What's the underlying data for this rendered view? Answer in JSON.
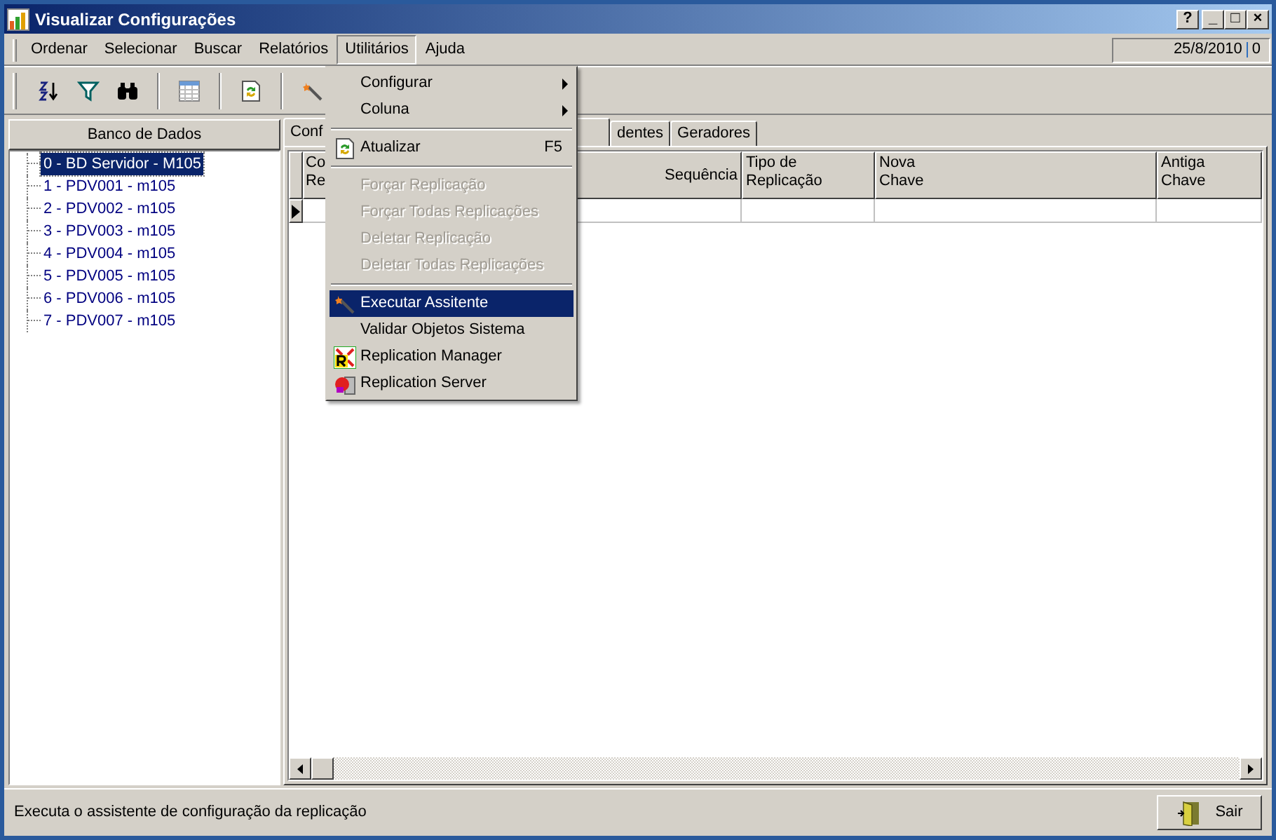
{
  "window": {
    "title": "Visualizar Configurações",
    "controls": [
      "?",
      "_",
      "□",
      "×"
    ]
  },
  "menubar": [
    {
      "label": "Ordenar",
      "open": false
    },
    {
      "label": "Selecionar",
      "open": false
    },
    {
      "label": "Buscar",
      "open": false
    },
    {
      "label": "Relatórios",
      "open": false
    },
    {
      "label": "Utilitários",
      "open": true
    },
    {
      "label": "Ajuda",
      "open": false
    }
  ],
  "status_info": {
    "date": "25/8/2010",
    "count": "0"
  },
  "toolbar": [
    {
      "kind": "sort"
    },
    {
      "kind": "filter"
    },
    {
      "kind": "find"
    },
    {
      "kind": "separator"
    },
    {
      "kind": "grid"
    },
    {
      "kind": "separator"
    },
    {
      "kind": "refresh"
    },
    {
      "kind": "separator"
    },
    {
      "kind": "wizard"
    }
  ],
  "sidebar": {
    "header": "Banco de Dados",
    "items": [
      {
        "label": "0 - BD Servidor - M105",
        "selected": true
      },
      {
        "label": "1 - PDV001 - m105",
        "selected": false
      },
      {
        "label": "2 - PDV002 - m105",
        "selected": false
      },
      {
        "label": "3 - PDV003 - m105",
        "selected": false
      },
      {
        "label": "4 - PDV004 - m105",
        "selected": false
      },
      {
        "label": "5 - PDV005 - m105",
        "selected": false
      },
      {
        "label": "6 - PDV006 - m105",
        "selected": false
      },
      {
        "label": "7 - PDV007 - m105",
        "selected": false
      }
    ]
  },
  "tabs": [
    {
      "label": "Conf",
      "selected": true
    },
    {
      "label": "dentes",
      "selected": false
    },
    {
      "label": "Geradores",
      "selected": false
    }
  ],
  "table": {
    "columns": [
      {
        "lines": [
          "Co",
          "Re"
        ]
      },
      {
        "lines": [
          "Sequência"
        ]
      },
      {
        "lines": [
          "Tipo de",
          "Replicação"
        ]
      },
      {
        "lines": [
          "Nova",
          "Chave"
        ]
      },
      {
        "lines": [
          "Antiga",
          "Chave"
        ]
      }
    ]
  },
  "menu": [
    {
      "kind": "submenu",
      "label": "Configurar"
    },
    {
      "kind": "submenu",
      "label": "Coluna"
    },
    {
      "kind": "separator"
    },
    {
      "kind": "item",
      "label": "Atualizar",
      "shortcut": "F5",
      "disabled": false,
      "selected": false
    },
    {
      "kind": "separator"
    },
    {
      "kind": "item",
      "label": "Forçar Replicação",
      "disabled": true,
      "selected": false
    },
    {
      "kind": "item",
      "label": "Forçar Todas Replicações",
      "disabled": true,
      "selected": false
    },
    {
      "kind": "item",
      "label": "Deletar Replicação",
      "disabled": true,
      "selected": false
    },
    {
      "kind": "item",
      "label": "Deletar Todas Replicações",
      "disabled": true,
      "selected": false
    },
    {
      "kind": "separator"
    },
    {
      "kind": "item",
      "label": "Executar Assitente",
      "disabled": false,
      "selected": true
    },
    {
      "kind": "item",
      "label": "Validar Objetos Sistema",
      "disabled": false,
      "selected": false
    },
    {
      "kind": "item",
      "label": "Replication Manager",
      "disabled": false,
      "selected": false
    },
    {
      "kind": "item",
      "label": "Replication Server",
      "disabled": false,
      "selected": false
    }
  ],
  "status_bar": {
    "text": "Executa o assistente de configuração da replicação",
    "button": "Sair"
  }
}
